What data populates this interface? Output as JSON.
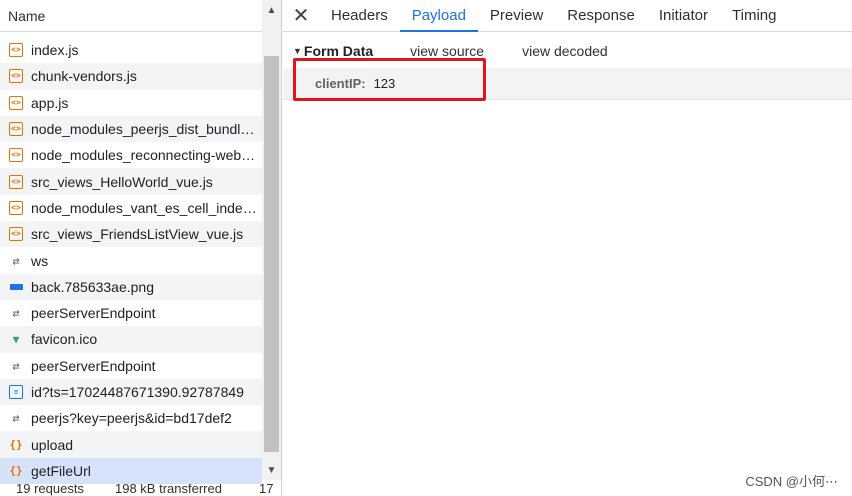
{
  "requests_panel": {
    "column_header": "Name",
    "rows": [
      {
        "icon": "script-icon",
        "label": "index.js"
      },
      {
        "icon": "script-icon",
        "label": "chunk-vendors.js"
      },
      {
        "icon": "script-icon",
        "label": "app.js"
      },
      {
        "icon": "script-icon",
        "label": "node_modules_peerjs_dist_bundler.mjs"
      },
      {
        "icon": "script-icon",
        "label": "node_modules_reconnecting-websocket"
      },
      {
        "icon": "script-icon",
        "label": "src_views_HelloWorld_vue.js"
      },
      {
        "icon": "script-icon",
        "label": "node_modules_vant_es_cell_index.js"
      },
      {
        "icon": "script-icon",
        "label": "src_views_FriendsListView_vue.js"
      },
      {
        "icon": "websocket-icon",
        "label": "ws"
      },
      {
        "icon": "image-icon",
        "label": "back.785633ae.png"
      },
      {
        "icon": "websocket-icon",
        "label": "peerServerEndpoint"
      },
      {
        "icon": "vue-icon",
        "label": "favicon.ico"
      },
      {
        "icon": "websocket-icon",
        "label": "peerServerEndpoint"
      },
      {
        "icon": "document-icon",
        "label": "id?ts=17024487671390.92787849"
      },
      {
        "icon": "websocket-icon",
        "label": "peerjs?key=peerjs&id=bd17def2"
      },
      {
        "icon": "fetch-icon",
        "label": "upload"
      },
      {
        "icon": "fetch-icon",
        "label": "getFileUrl"
      }
    ],
    "selected_index": 16,
    "status": {
      "requests": "19 requests",
      "transferred": "198 kB transferred",
      "extra": "17"
    }
  },
  "details_panel": {
    "close_glyph": "✕",
    "tabs": [
      {
        "label": "Headers"
      },
      {
        "label": "Payload"
      },
      {
        "label": "Preview"
      },
      {
        "label": "Response"
      },
      {
        "label": "Initiator"
      },
      {
        "label": "Timing"
      }
    ],
    "active_tab": "Payload",
    "form_data": {
      "title": "Form Data",
      "view_source": "view source",
      "view_decoded": "view decoded",
      "fields": [
        {
          "key": "clientIP:",
          "value": "123"
        }
      ]
    }
  },
  "watermark": "CSDN @小何⋯",
  "colors": {
    "accent": "#1a73e8",
    "selected_row": "#d6e2fb",
    "highlight_box": "#e1141e"
  }
}
